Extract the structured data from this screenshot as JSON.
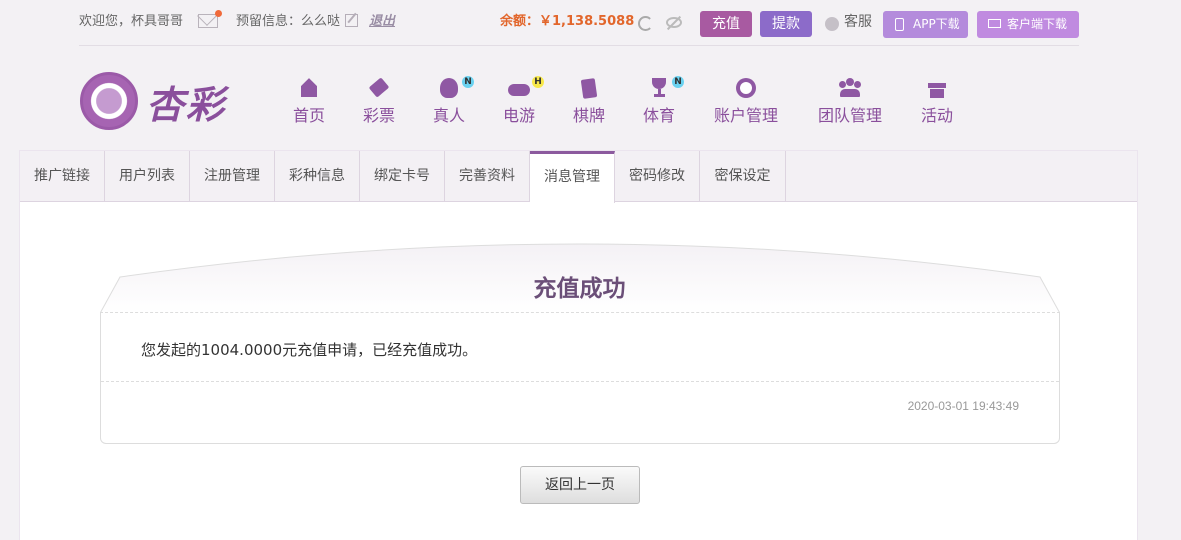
{
  "topbar": {
    "welcome": "欢迎您，杯具哥哥",
    "reserved": "预留信息：么么哒",
    "logout": "退出",
    "balance": "余额：￥1,138.5088",
    "recharge": "充值",
    "withdraw": "提款",
    "service": "客服",
    "app_download": "APP下载",
    "client_download": "客户端下载"
  },
  "logo": {
    "text": "杏彩"
  },
  "nav": [
    {
      "label": "首页",
      "icon": "home-icon"
    },
    {
      "label": "彩票",
      "icon": "ticket-icon"
    },
    {
      "label": "真人",
      "icon": "woman-icon",
      "badge": "N"
    },
    {
      "label": "电游",
      "icon": "gamepad-icon",
      "badge": "H"
    },
    {
      "label": "棋牌",
      "icon": "cards-icon"
    },
    {
      "label": "体育",
      "icon": "trophy-icon",
      "badge": "N"
    },
    {
      "label": "账户管理",
      "icon": "yen-coin-icon"
    },
    {
      "label": "团队管理",
      "icon": "team-icon"
    },
    {
      "label": "活动",
      "icon": "gift-icon"
    }
  ],
  "tabs": [
    "推广链接",
    "用户列表",
    "注册管理",
    "彩种信息",
    "绑定卡号",
    "完善资料",
    "消息管理",
    "密码修改",
    "密保设定"
  ],
  "active_tab": "消息管理",
  "message": {
    "title": "充值成功",
    "body": "您发起的1004.0000元充值申请，已经充值成功。",
    "time": "2020-03-01 19:43:49",
    "back": "返回上一页"
  },
  "colors": {
    "brand": "#8c5a9e",
    "balance": "#e2662b",
    "recharge": "#a85aa1",
    "withdraw": "#8c6bc9"
  }
}
